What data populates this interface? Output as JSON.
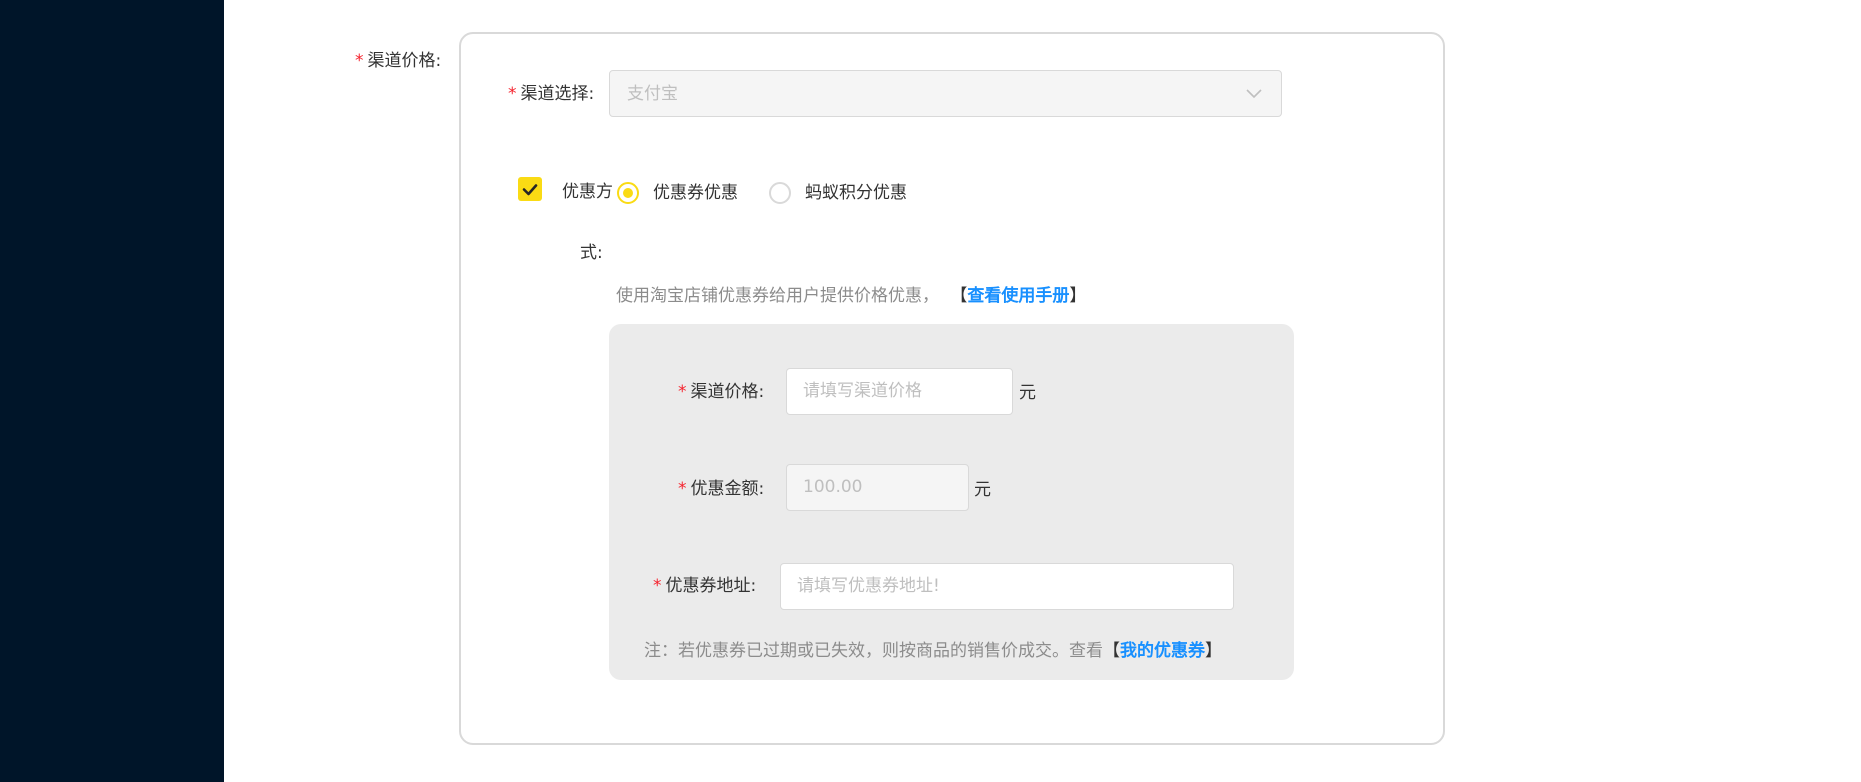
{
  "form": {
    "outer_label": "渠道价格:",
    "channel_select": {
      "label": "渠道选择:",
      "value": "支付宝"
    },
    "discount": {
      "checkbox_label_line1": "优惠方",
      "checkbox_label_line2": "式:",
      "options": [
        "优惠券优惠",
        "蚂蚁积分优惠"
      ],
      "selected": "优惠券优惠",
      "description": "使用淘宝店铺优惠券给用户提供价格优惠，",
      "manual_link": "查看使用手册",
      "bracket_open": "【",
      "bracket_close": "】"
    },
    "coupon": {
      "price_label": "渠道价格:",
      "price_placeholder": "请填写渠道价格",
      "price_unit": "元",
      "amount_label": "优惠金额:",
      "amount_value": "100.00",
      "amount_unit": "元",
      "url_label": "优惠券地址:",
      "url_placeholder": "请填写优惠券地址!",
      "note": "注：若优惠券已过期或已失效，则按商品的销售价成交。查看",
      "my_coupons_link": "我的优惠券",
      "bracket_open": "【",
      "bracket_close": "】"
    }
  },
  "colors": {
    "sidebar": "#001529",
    "required": "#f5222d",
    "accent": "#fadb14",
    "link": "#1890ff"
  }
}
